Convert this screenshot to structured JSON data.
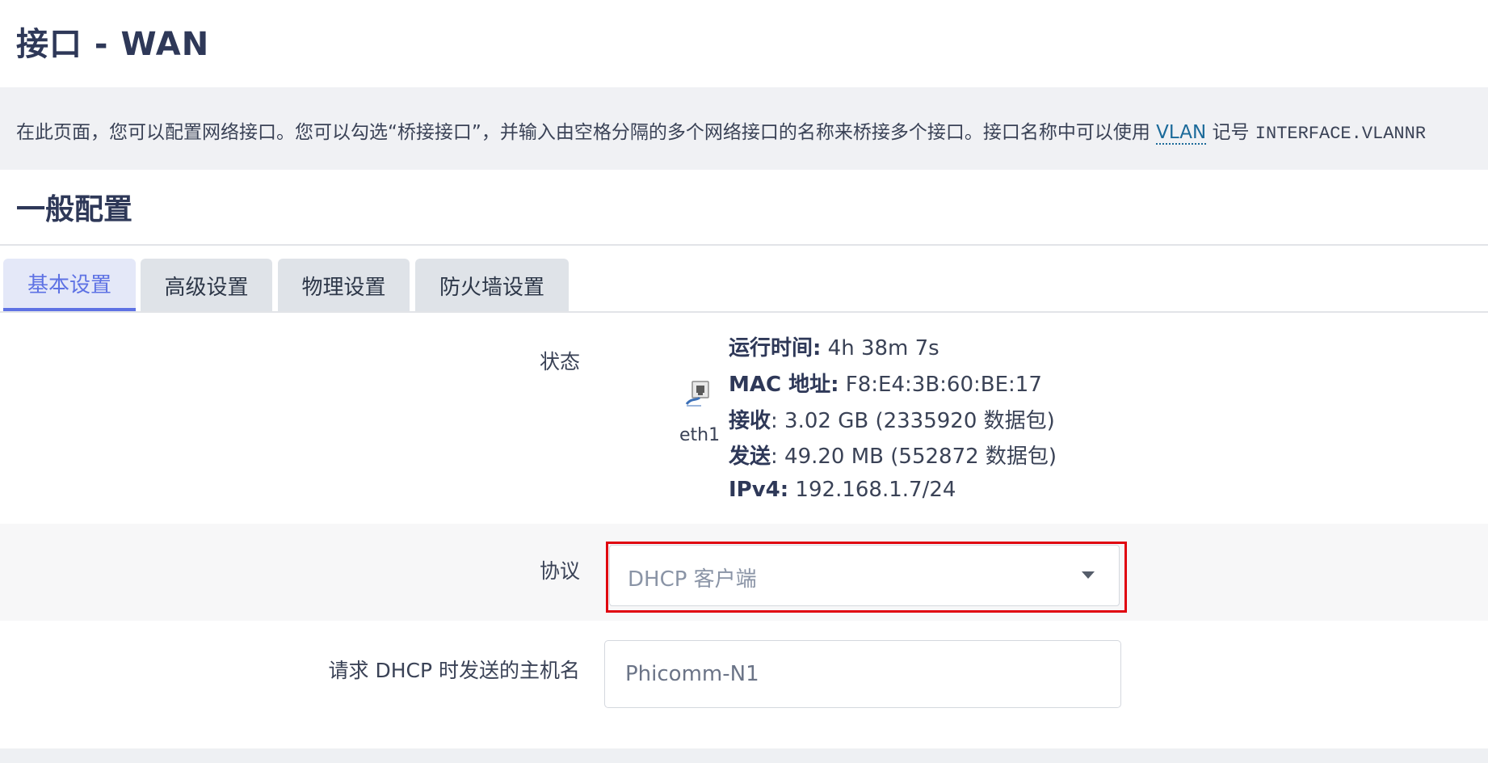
{
  "page": {
    "title": "接口 - WAN",
    "description_prefix": "在此页面，您可以配置网络接口。您可以勾选“桥接接口”，并输入由空格分隔的多个网络接口的名称来桥接多个接口。接口名称中可以使用 ",
    "description_link": "VLAN",
    "description_mid": " 记号 ",
    "description_code": "INTERFACE.VLANNR"
  },
  "section": {
    "title": "一般配置"
  },
  "tabs": [
    {
      "label": "基本设置",
      "active": true
    },
    {
      "label": "高级设置",
      "active": false
    },
    {
      "label": "物理设置",
      "active": false
    },
    {
      "label": "防火墙设置",
      "active": false
    }
  ],
  "status": {
    "label": "状态",
    "interface": "eth1",
    "icon": "network-port-icon",
    "lines": [
      {
        "key": "运行时间:",
        "value": " 4h 38m 7s"
      },
      {
        "key": "MAC 地址:",
        "value": " F8:E4:3B:60:BE:17"
      },
      {
        "key": "接收",
        "value": ": 3.02 GB (2335920 数据包)"
      },
      {
        "key": "发送",
        "value": ": 49.20 MB (552872 数据包)"
      },
      {
        "key": "IPv4:",
        "value": " 192.168.1.7/24"
      }
    ]
  },
  "protocol": {
    "label": "协议",
    "selected": "DHCP 客户端"
  },
  "hostname": {
    "label": "请求 DHCP 时发送的主机名",
    "value": "Phicomm-N1"
  },
  "colors": {
    "accent": "#5e72e4",
    "highlight": "#e0000f",
    "title": "#2e3858",
    "link": "#1b6a9a"
  }
}
